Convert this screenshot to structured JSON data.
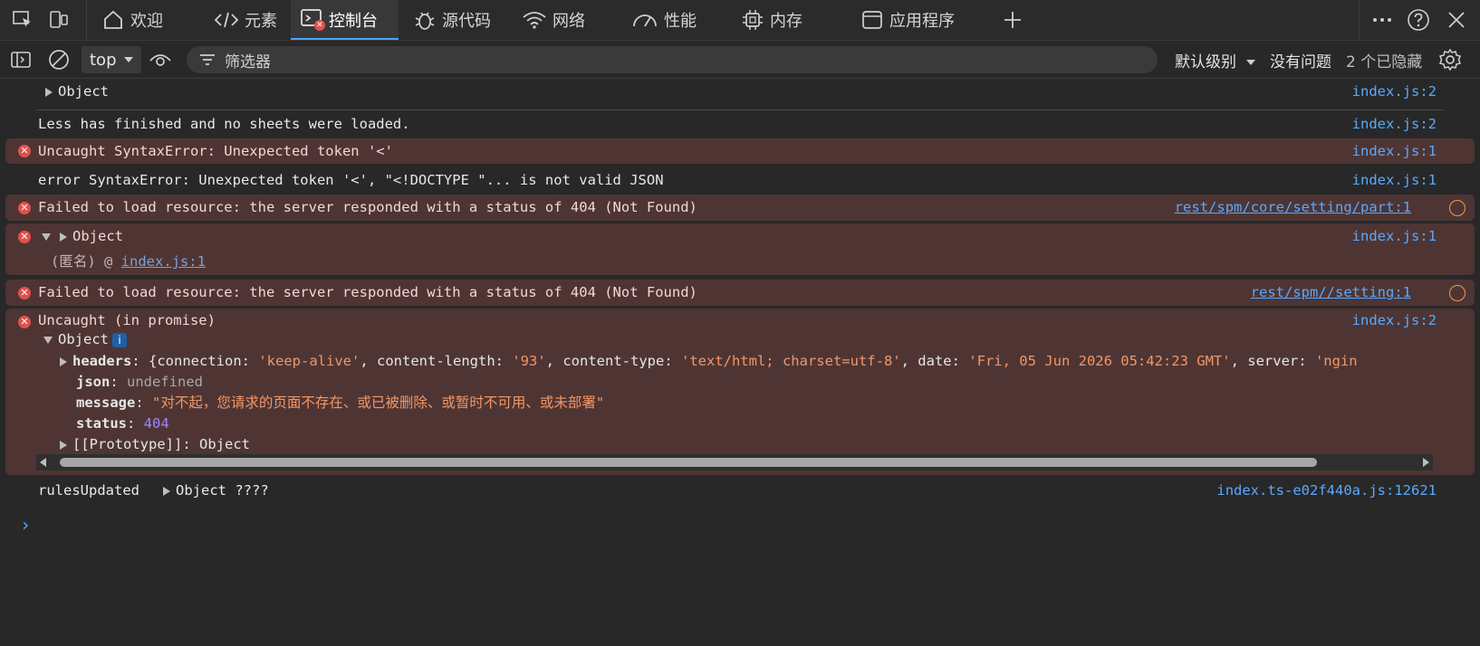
{
  "tabs": [
    {
      "label": "欢迎",
      "icon": "home-icon"
    },
    {
      "label": "元素",
      "icon": "code-icon"
    },
    {
      "label": "控制台",
      "icon": "console-icon",
      "active": true
    },
    {
      "label": "源代码",
      "icon": "bug-icon"
    },
    {
      "label": "网络",
      "icon": "wifi-icon"
    },
    {
      "label": "性能",
      "icon": "gauge-icon"
    },
    {
      "label": "内存",
      "icon": "chip-icon"
    },
    {
      "label": "应用程序",
      "icon": "window-icon"
    }
  ],
  "toolbar": {
    "context": "top",
    "filter_placeholder": "筛选器",
    "levels": "默认级别",
    "issues": "没有问题",
    "hidden": "2 个已隐藏"
  },
  "colors": {
    "accent": "#4da3ff",
    "error_bg": "#4e3534",
    "link": "#5aa9ff",
    "error_icon": "#e2504d"
  },
  "console": {
    "r1": {
      "text": "Object",
      "source": "index.js:2"
    },
    "r2": {
      "text": "Less has finished and no sheets were loaded.",
      "source": "index.js:2"
    },
    "r3": {
      "text": "Uncaught SyntaxError: Unexpected token '<'",
      "source": "index.js:1"
    },
    "r4": {
      "text": "error SyntaxError: Unexpected token '<', \"<!DOCTYPE \"... is not valid JSON",
      "source": "index.js:1"
    },
    "r5": {
      "text": "Failed to load resource: the server responded with a status of 404 (Not Found)",
      "source": "rest/spm/core/setting/part:1"
    },
    "r6": {
      "text": "Object",
      "source": "index.js:1",
      "stack_prefix": "(匿名) @ ",
      "stack_link": "index.js:1"
    },
    "r7": {
      "text": "Failed to load resource: the server responded with a status of 404 (Not Found)",
      "source": "rest/spm//setting:1"
    },
    "r8": {
      "text": "Uncaught (in promise)",
      "source": "index.js:2",
      "object_label": "Object",
      "info_badge": "i",
      "headers_key": "headers",
      "headers_open": "{",
      "headers_parts": [
        {
          "k": "connection",
          "v": "'keep-alive'"
        },
        {
          "k": "content-length",
          "v": "'93'"
        },
        {
          "k": "content-type",
          "v": "'text/html; charset=utf-8'"
        },
        {
          "k": "date",
          "v": "'Fri, 05 Jun 2026 05:42:23 GMT'"
        },
        {
          "k": "server",
          "v": "'ngin"
        }
      ],
      "json_key": "json",
      "json_val": "undefined",
      "message_key": "message",
      "message_val": "\"对不起，您请求的页面不存在、或已被删除、或暂时不可用、或未部署\"",
      "status_key": "status",
      "status_val": "404",
      "proto_key": "[[Prototype]]",
      "proto_val": "Object"
    },
    "r9": {
      "label": "rulesUpdated",
      "text": "Object ????",
      "source": "index.ts-e02f440a.js:12621"
    },
    "prompt": "›"
  }
}
